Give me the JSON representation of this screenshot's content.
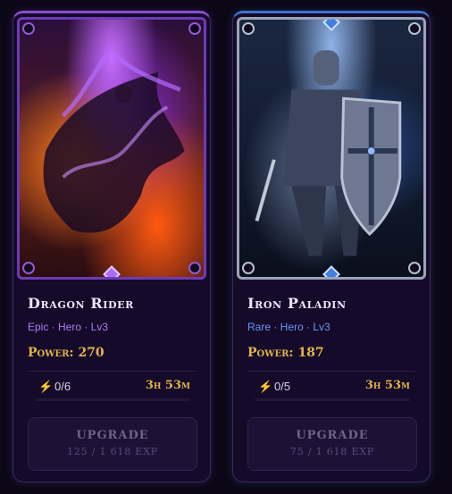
{
  "cards": [
    {
      "name": "Dragon Rider",
      "meta": "Epic · Hero · Lv3",
      "power": "Power: 270",
      "energy": "0/6",
      "energy_fraction": 0,
      "timer": "3h 53m",
      "upgrade_label": "UPGRADE",
      "upgrade_cost": "125 / 1 618 EXP",
      "rarity_color": "#8a4fd2",
      "icon": "bolt-icon"
    },
    {
      "name": "Iron Paladin",
      "meta": "Rare · Hero · Lv3",
      "power": "Power: 187",
      "energy": "0/5",
      "energy_fraction": 0,
      "timer": "3h 53m",
      "upgrade_label": "UPGRADE",
      "upgrade_cost": "75 / 1 618 EXP",
      "rarity_color": "#3f72cf",
      "icon": "bolt-icon"
    }
  ],
  "colors": {
    "gold": "#e3b34a",
    "background": "#0c0716"
  }
}
